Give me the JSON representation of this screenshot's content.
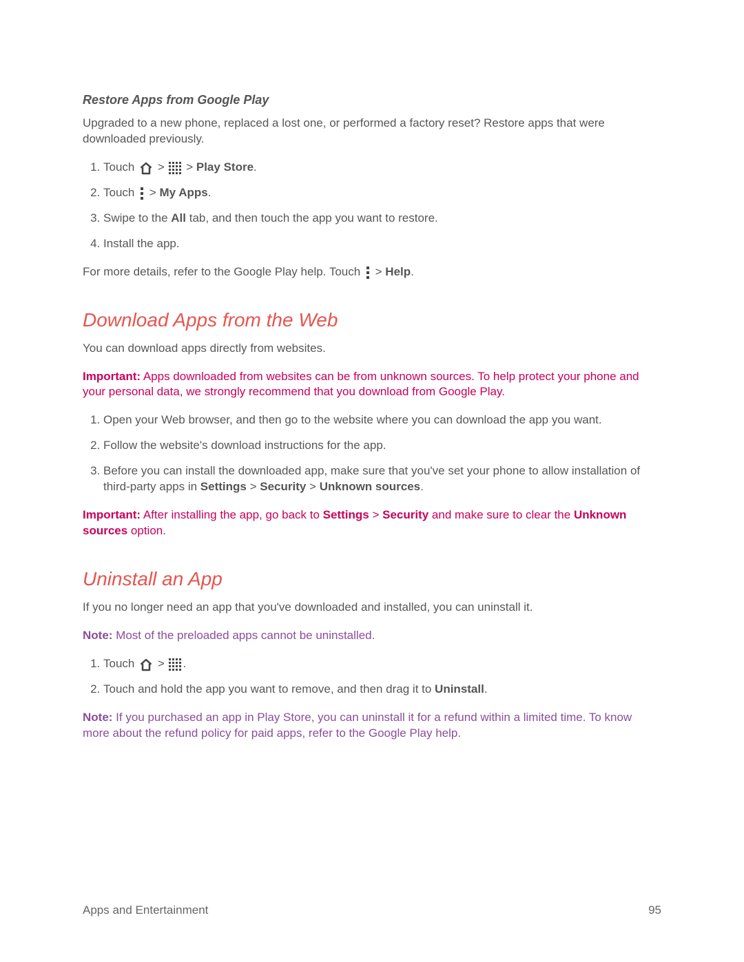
{
  "section1": {
    "title": "Restore Apps from Google Play",
    "intro": "Upgraded to a new phone, replaced a lost one, or performed a factory reset? Restore apps that were downloaded previously.",
    "step1_a": "Touch ",
    "step1_b": " > ",
    "step1_c": " > ",
    "step1_playstore": "Play Store",
    "step1_end": ".",
    "step2_a": "Touch ",
    "step2_b": " > ",
    "step2_myapps": "My Apps",
    "step2_end": ".",
    "step3_a": "Swipe to the ",
    "step3_all": "All",
    "step3_b": " tab, and then touch the app you want to restore.",
    "step4": "Install the app.",
    "after_a": "For more details, refer to the Google Play help. Touch ",
    "after_b": " > ",
    "after_help": "Help",
    "after_end": "."
  },
  "section2": {
    "title": "Download Apps from the Web",
    "intro": "You can download apps directly from websites.",
    "warn1_label": "Important:",
    "warn1_text": "  Apps downloaded from websites can be from unknown sources. To help protect your phone and your personal data, we strongly recommend that you download from Google Play.",
    "step1": "Open your Web browser, and then go to the website where you can download the app you want.",
    "step2": "Follow the website's download instructions for the app.",
    "step3_a": "Before you can install the downloaded app, make sure that you've set your phone to allow installation of third-party apps in ",
    "step3_settings": "Settings",
    "step3_gt1": " > ",
    "step3_security": "Security",
    "step3_gt2": " > ",
    "step3_unknown": "Unknown sources",
    "step3_end": ".",
    "warn2_label": "Important:",
    "warn2_a": "  After installing the app, go back to ",
    "warn2_settings": "Settings",
    "warn2_gt": " > ",
    "warn2_security": "Security",
    "warn2_b": " and make sure to clear the ",
    "warn2_unknown": "Unknown sources",
    "warn2_c": " option."
  },
  "section3": {
    "title": "Uninstall an App",
    "intro": "If you no longer need an app that you've downloaded and installed, you can uninstall it.",
    "note1_label": "Note:",
    "note1_text": "  Most of the preloaded apps cannot be uninstalled.",
    "step1_a": "Touch ",
    "step1_b": " > ",
    "step1_end": ".",
    "step2_a": "Touch and hold the app you want to remove, and then drag it to ",
    "step2_uninstall": "Uninstall",
    "step2_end": ".",
    "note2_label": "Note:",
    "note2_text": "  If you purchased an app in Play Store, you can uninstall it for a refund within a limited time. To know more about the refund policy for paid apps, refer to the Google Play help."
  },
  "footer": {
    "section": "Apps and Entertainment",
    "page": "95"
  }
}
